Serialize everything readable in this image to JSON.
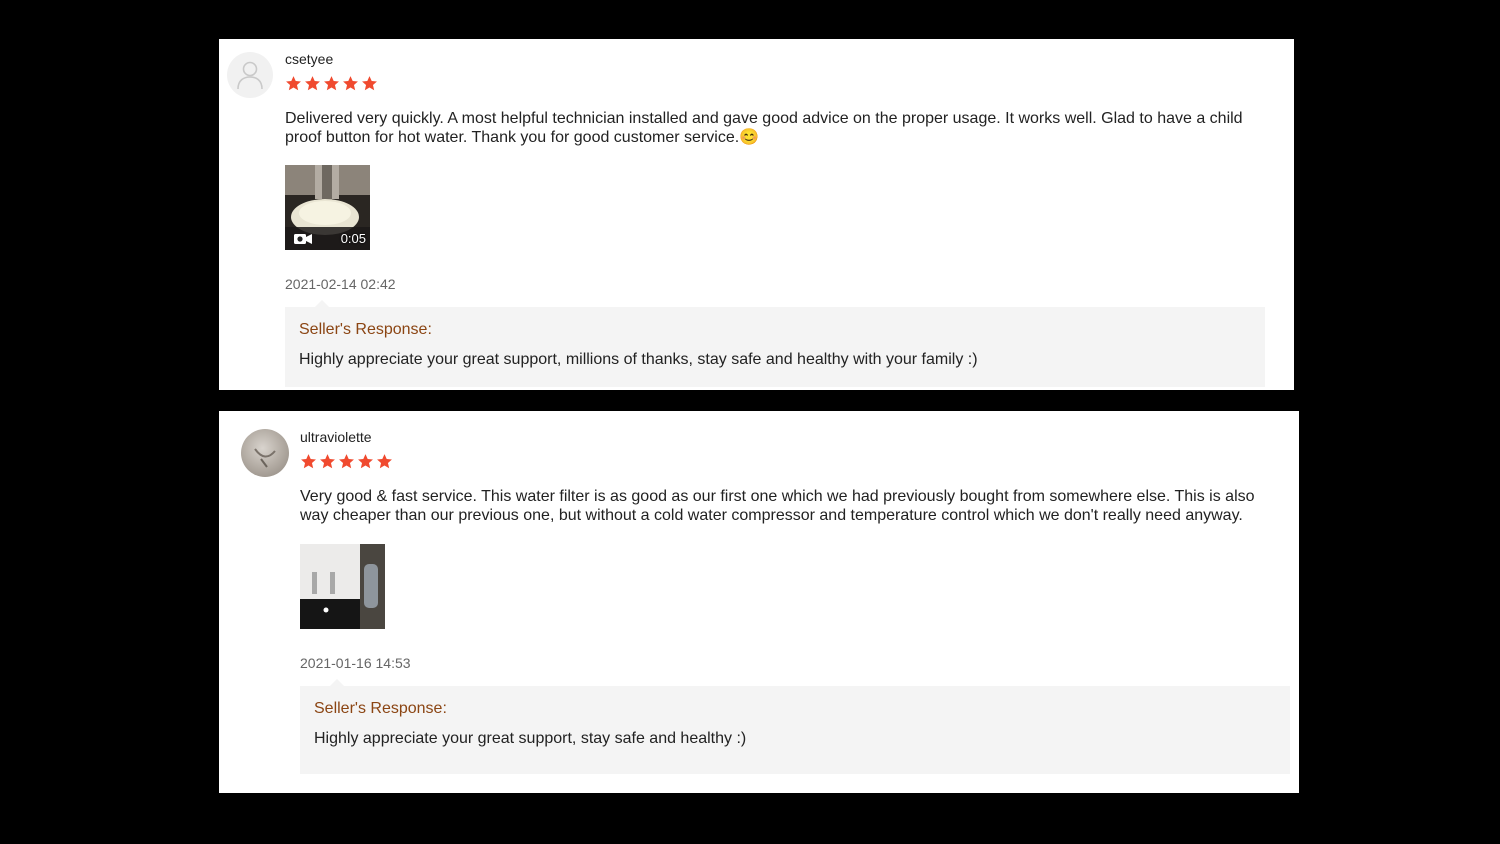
{
  "reviews": [
    {
      "username": "csetyee",
      "rating": 5,
      "star_color": "#f04a2f",
      "text": "Delivered very quickly. A most helpful technician installed and gave good advice on the proper usage. It works well. Glad to have a child proof button for hot water. Thank you for good customer service.😊",
      "media": {
        "type": "video",
        "duration": "0:05",
        "icon": "video-camera-icon"
      },
      "date": "2021-02-14 02:42",
      "seller_response": {
        "label": "Seller's Response:",
        "text": "Highly appreciate your great support, millions of thanks, stay safe and healthy with your family :)"
      }
    },
    {
      "username": "ultraviolette",
      "rating": 5,
      "star_color": "#f04a2f",
      "text": "Very good & fast service. This water filter is as good as our first one which we had previously bought from somewhere else.  This is also way cheaper than our previous one, but without a cold water compressor and temperature control which we don't really need anyway.",
      "media": {
        "type": "image"
      },
      "date": "2021-01-16 14:53",
      "seller_response": {
        "label": "Seller's Response:",
        "text": "Highly appreciate your great support, stay safe and healthy :)"
      }
    }
  ],
  "colors": {
    "background": "#000000",
    "card": "#ffffff",
    "response_bg": "#f4f4f4",
    "response_label": "#8b4513"
  }
}
